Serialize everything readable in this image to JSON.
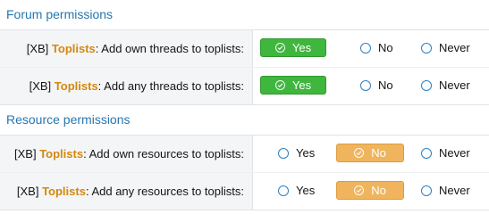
{
  "sections": [
    {
      "title": "Forum permissions",
      "rows": [
        {
          "prefix": "[XB] ",
          "addon": "Toplists",
          "suffix": ": Add own threads to toplists:",
          "selected": "Yes"
        },
        {
          "prefix": "[XB] ",
          "addon": "Toplists",
          "suffix": ": Add any threads to toplists:",
          "selected": "Yes"
        }
      ]
    },
    {
      "title": "Resource permissions",
      "rows": [
        {
          "prefix": "[XB] ",
          "addon": "Toplists",
          "suffix": ": Add own resources to toplists:",
          "selected": "No"
        },
        {
          "prefix": "[XB] ",
          "addon": "Toplists",
          "suffix": ": Add any resources to toplists:",
          "selected": "No"
        }
      ]
    }
  ],
  "options": {
    "yes": "Yes",
    "no": "No",
    "never": "Never"
  },
  "colors": {
    "section_title": "#2577b1",
    "addon": "#d4880e",
    "yes_selected": "#3fb63d",
    "no_selected": "#f0b45d",
    "radio": "#2e7fc4"
  },
  "icons": {
    "selected": "check-circle-icon",
    "unselected": "radio-circle-icon"
  }
}
